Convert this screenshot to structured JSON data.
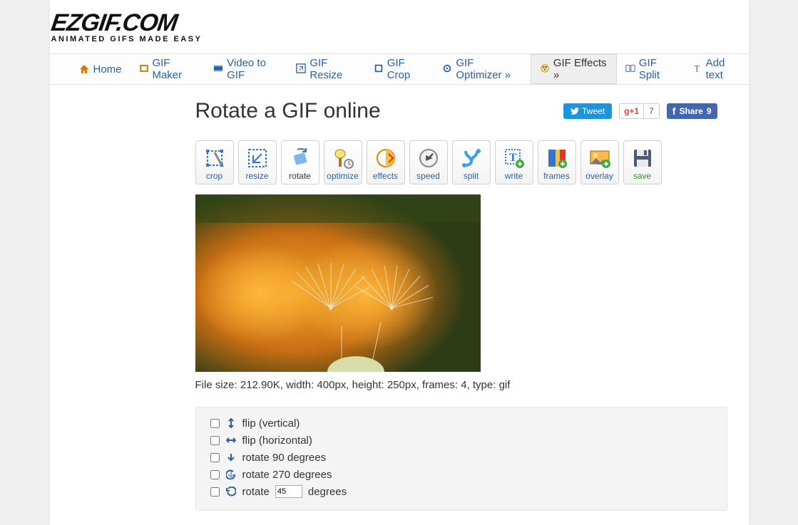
{
  "logo": {
    "main": "EZGIF.COM",
    "sub": "ANIMATED GIFS MADE EASY"
  },
  "nav": [
    {
      "label": "Home"
    },
    {
      "label": "GIF Maker"
    },
    {
      "label": "Video to GIF"
    },
    {
      "label": "GIF Resize"
    },
    {
      "label": "GIF Crop"
    },
    {
      "label": "GIF Optimizer »"
    },
    {
      "label": "GIF Effects »"
    },
    {
      "label": "GIF Split"
    },
    {
      "label": "Add text"
    }
  ],
  "nav_active": 6,
  "page_title": "Rotate a GIF online",
  "share": {
    "tweet": "Tweet",
    "gplus_label": "+1",
    "gplus_count": "7",
    "fb_label": "Share",
    "fb_count": "9"
  },
  "toolbar": [
    {
      "label": "crop"
    },
    {
      "label": "resize"
    },
    {
      "label": "rotate"
    },
    {
      "label": "optimize"
    },
    {
      "label": "effects"
    },
    {
      "label": "speed"
    },
    {
      "label": "split"
    },
    {
      "label": "write"
    },
    {
      "label": "frames"
    },
    {
      "label": "overlay"
    },
    {
      "label": "save"
    }
  ],
  "toolbar_active": 2,
  "file_info": "File size: 212.90K, width: 400px, height: 250px, frames: 4, type: gif",
  "options": {
    "flip_v": "flip (vertical)",
    "flip_h": "flip (horizontal)",
    "rot90": "rotate 90 degrees",
    "rot270": "rotate 270 degrees",
    "rot_custom_pre": "rotate",
    "rot_custom_value": "45",
    "rot_custom_post": "degrees"
  }
}
